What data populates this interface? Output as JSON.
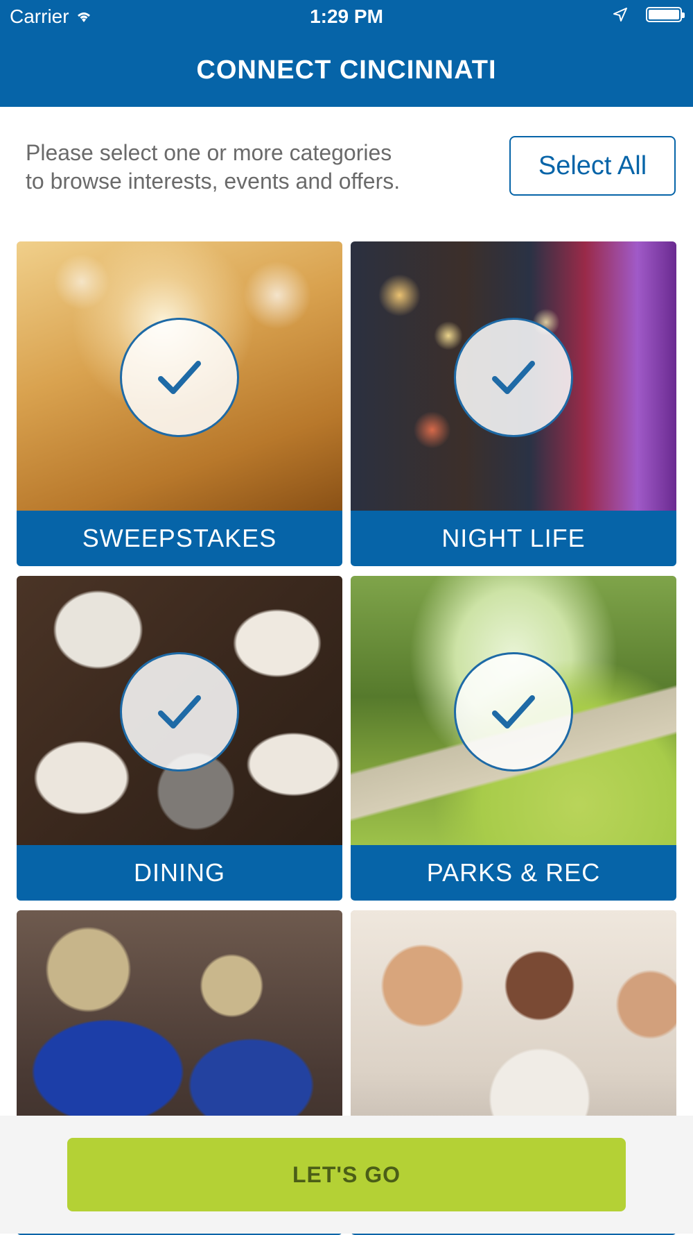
{
  "status_bar": {
    "carrier": "Carrier",
    "time": "1:29 PM"
  },
  "header": {
    "title": "CONNECT CINCINNATI"
  },
  "intro": {
    "text_line1": "Please select one or more categories",
    "text_line2": "to browse interests, events and offers.",
    "select_all_label": "Select All"
  },
  "categories": [
    {
      "label": "SWEEPSTAKES",
      "selected": true
    },
    {
      "label": "NIGHT LIFE",
      "selected": true
    },
    {
      "label": "DINING",
      "selected": true
    },
    {
      "label": "PARKS & REC",
      "selected": true
    },
    {
      "label": "",
      "selected": false
    },
    {
      "label": "",
      "selected": false
    }
  ],
  "footer": {
    "go_label": "LET'S GO"
  },
  "colors": {
    "brand_blue": "#0664a8",
    "go_green": "#b4d135"
  }
}
